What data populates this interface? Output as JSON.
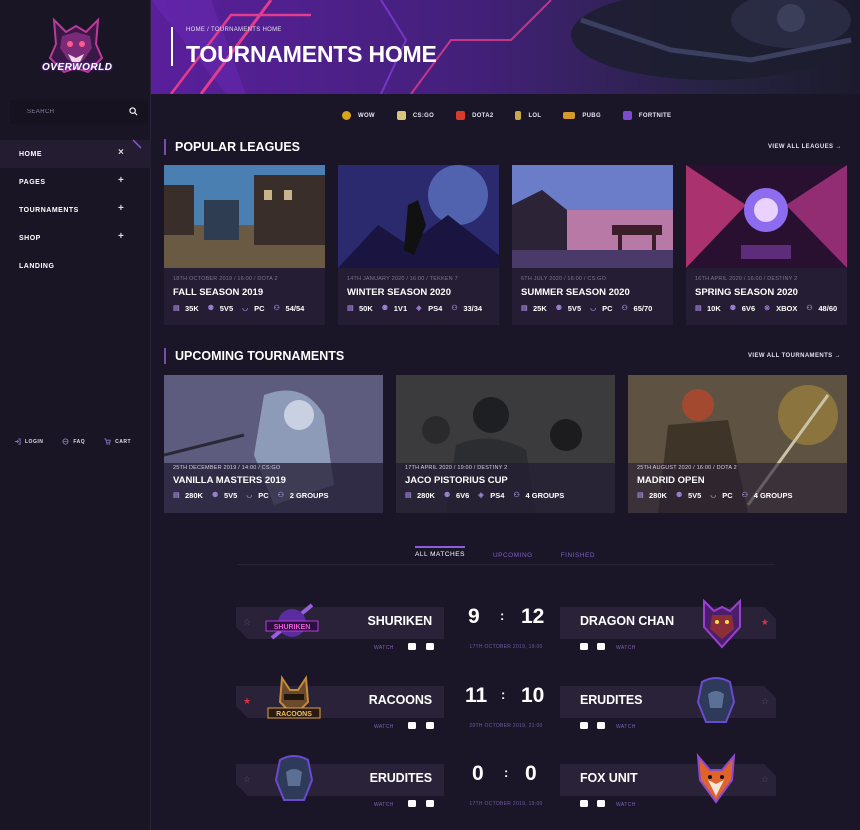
{
  "brand": {
    "name": "OVERWORLD"
  },
  "sidebar": {
    "search_placeholder": "SEARCH",
    "nav": [
      {
        "label": "HOME",
        "symbol": "×"
      },
      {
        "label": "PAGES",
        "symbol": "+"
      },
      {
        "label": "TOURNAMENTS",
        "symbol": "+"
      },
      {
        "label": "SHOP",
        "symbol": "+"
      },
      {
        "label": "LANDING",
        "symbol": ""
      }
    ],
    "bottom": [
      {
        "label": "LOGIN",
        "icon": "login-icon"
      },
      {
        "label": "FAQ",
        "icon": "globe-icon"
      },
      {
        "label": "CART",
        "icon": "cart-icon"
      }
    ]
  },
  "hero": {
    "breadcrumb": "HOME / TOURNAMENTS HOME",
    "title": "TOURNAMENTS HOME"
  },
  "games": [
    {
      "label": "WOW",
      "color": "#d9a31c"
    },
    {
      "label": "CS:GO",
      "color": "#d8c47a"
    },
    {
      "label": "DOTA2",
      "color": "#d83a2b"
    },
    {
      "label": "LOL",
      "color": "#c9a84a"
    },
    {
      "label": "PUBG",
      "color": "#d69a2a"
    },
    {
      "label": "FORTNITE",
      "color": "#7a4bd0"
    }
  ],
  "popular": {
    "title": "POPULAR LEAGUES",
    "view_all": "VIEW ALL LEAGUES",
    "cards": [
      {
        "meta": "18TH OCTOBER 2019  /  16:00  /  DOTA 2",
        "title": "FALL SEASON 2019",
        "stats": [
          "35K",
          "5V5",
          "PC",
          "54/54"
        ]
      },
      {
        "meta": "14TH JANUARY 2020  /  16:00  /  TEKKEN 7",
        "title": "WINTER SEASON 2020",
        "stats": [
          "50K",
          "1V1",
          "PS4",
          "33/34"
        ]
      },
      {
        "meta": "6TH JULY 2020  /  16:00  /  CS:GO",
        "title": "SUMMER SEASON 2020",
        "stats": [
          "25K",
          "5V5",
          "PC",
          "65/70"
        ]
      },
      {
        "meta": "16TH APRIL 2020  /  16:00  /  DESTINY 2",
        "title": "SPRING SEASON 2020",
        "stats": [
          "10K",
          "6V6",
          "XBOX",
          "48/60"
        ]
      }
    ]
  },
  "upcoming": {
    "title": "UPCOMING TOURNAMENTS",
    "view_all": "VIEW ALL TOURNAMENTS",
    "cards": [
      {
        "meta": "25TH DECEMBER 2019  /  14:00  /  CS:GO",
        "title": "VANILLA MASTERS 2019",
        "stats": [
          "280K",
          "5V5",
          "PC",
          "2 GROUPS"
        ]
      },
      {
        "meta": "17TH APRIL 2020  /  19:00  /  DESTINY 2",
        "title": "JACO PISTORIUS CUP",
        "stats": [
          "280K",
          "6V6",
          "PS4",
          "4 GROUPS"
        ]
      },
      {
        "meta": "25TH AUGUST 2020  /  16:00  /  DOTA 2",
        "title": "MADRID OPEN",
        "stats": [
          "280K",
          "5V5",
          "PC",
          "4 GROUPS"
        ]
      }
    ]
  },
  "tabs": [
    "ALL MATCHES",
    "UPCOMING",
    "FINISHED"
  ],
  "matches": [
    {
      "team1": "SHURIKEN",
      "score1": "9",
      "team2": "DRAGON CHAN",
      "score2": "12",
      "date": "17TH OCTOBER 2019, 19:00",
      "watch": "WATCH",
      "fav1": false,
      "fav2": true
    },
    {
      "team1": "RACOONS",
      "score1": "11",
      "team2": "ERUDITES",
      "score2": "10",
      "date": "20TH OCTOBER 2019, 21:00",
      "watch": "WATCH",
      "fav1": true,
      "fav2": false
    },
    {
      "team1": "ERUDITES",
      "score1": "0",
      "team2": "FOX UNIT",
      "score2": "0",
      "date": "17TH OCTOBER 2019, 19:00",
      "watch": "WATCH",
      "fav1": false,
      "fav2": false
    }
  ],
  "badge_texts": {
    "shuriken": "SHURIKEN",
    "racoons": "RACOONS"
  },
  "colors": {
    "accent": "#8f5ce0",
    "star_active": "#e0313f",
    "star_idle": "#5b4a78"
  }
}
